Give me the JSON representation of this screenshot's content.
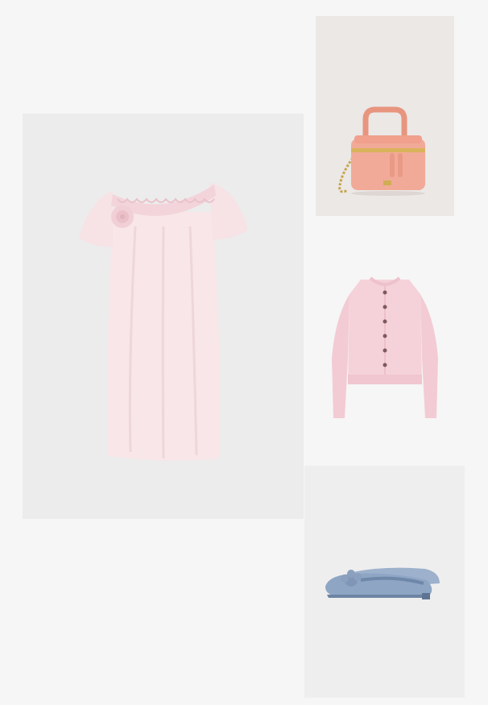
{
  "collage": {
    "items": [
      {
        "id": "dress",
        "icon": "pink-ruffle-dress-icon",
        "color": "#f7e4e6"
      },
      {
        "id": "bag",
        "icon": "pink-vanity-handbag-icon",
        "color": "#f2a996"
      },
      {
        "id": "cardigan",
        "icon": "pink-cardigan-icon",
        "color": "#f4cdd6"
      },
      {
        "id": "shoes",
        "icon": "blue-ballet-flat-icon",
        "color": "#8fa6c4"
      }
    ],
    "background": "#f6f6f6"
  }
}
